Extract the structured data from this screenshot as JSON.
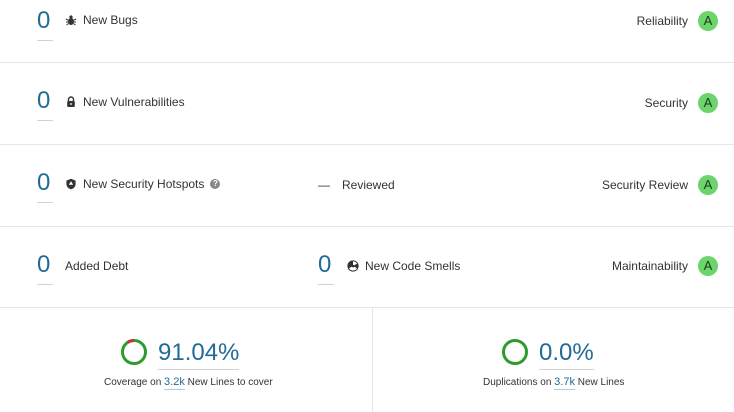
{
  "rows": {
    "bugs": {
      "value": "0",
      "label": "New Bugs",
      "rating_label": "Reliability",
      "rating": "A"
    },
    "vulnerabilities": {
      "value": "0",
      "label": "New Vulnerabilities",
      "rating_label": "Security",
      "rating": "A"
    },
    "hotspots": {
      "value": "0",
      "label": "New Security Hotspots",
      "middle_value": "—",
      "middle_label": "Reviewed",
      "rating_label": "Security Review",
      "rating": "A"
    },
    "maintainability": {
      "value": "0",
      "label": "Added Debt",
      "middle_value": "0",
      "middle_label": "New Code Smells",
      "rating_label": "Maintainability",
      "rating": "A"
    }
  },
  "coverage": {
    "value": "91.04%",
    "caption_prefix": "Coverage on",
    "lines_value": "3.2k",
    "caption_suffix": "New Lines to cover"
  },
  "duplications": {
    "value": "0.0%",
    "caption_prefix": "Duplications on",
    "lines_value": "3.7k",
    "caption_suffix": "New Lines"
  }
}
